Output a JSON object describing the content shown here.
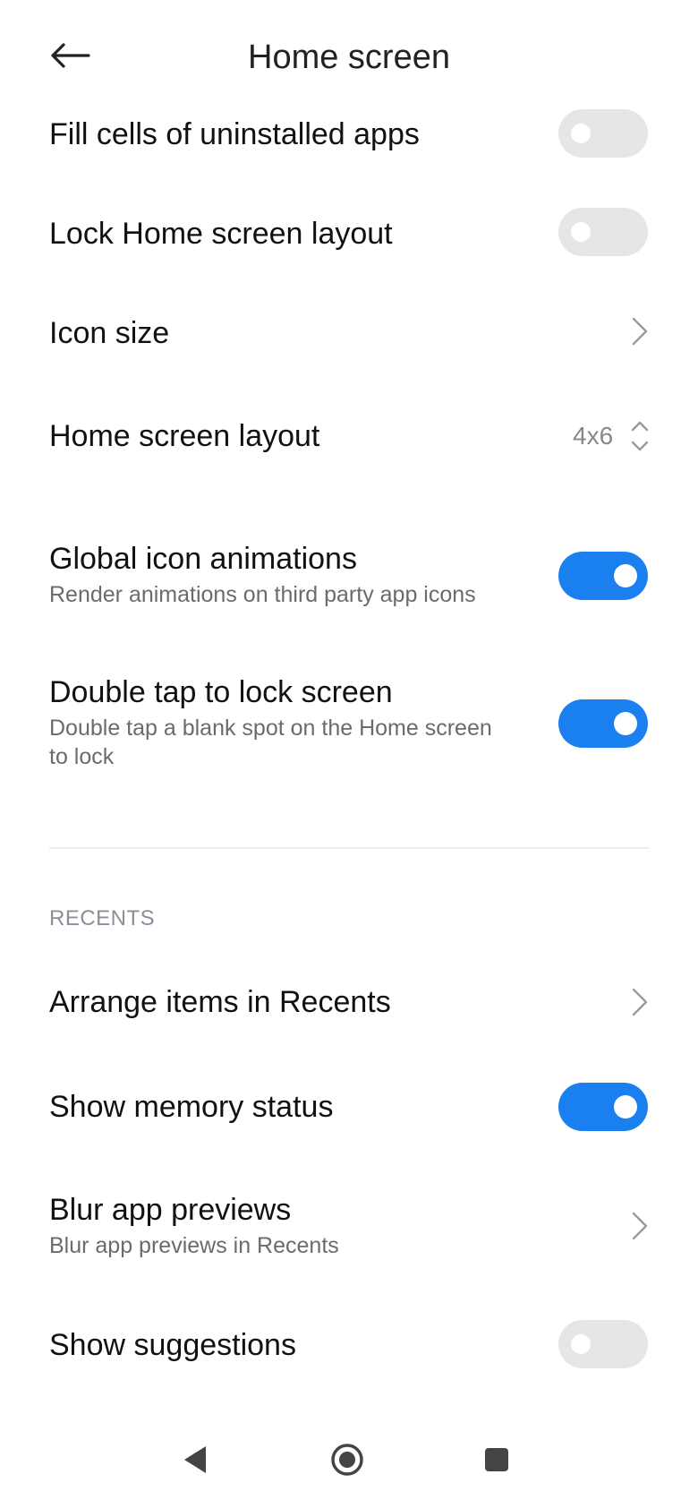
{
  "header": {
    "title": "Home screen",
    "back_icon": "arrow-left-icon"
  },
  "settings": {
    "fill_cells": {
      "title": "Fill cells of uninstalled apps",
      "enabled": false
    },
    "lock_layout": {
      "title": "Lock Home screen layout",
      "enabled": false
    },
    "icon_size": {
      "title": "Icon size"
    },
    "home_layout": {
      "title": "Home screen layout",
      "value": "4x6"
    },
    "global_icon_animations": {
      "title": "Global icon animations",
      "subtitle": "Render animations on third party app icons",
      "enabled": true
    },
    "double_tap_lock": {
      "title": "Double tap to lock screen",
      "subtitle_line1": "Double tap a blank spot on the Home screen",
      "subtitle_line2": "to lock",
      "enabled": true
    }
  },
  "recents": {
    "section_label": "RECENTS",
    "arrange_items": {
      "title": "Arrange items in Recents"
    },
    "memory_status": {
      "title": "Show memory status",
      "enabled": true
    },
    "blur_previews": {
      "title": "Blur app previews",
      "subtitle": "Blur app previews in Recents"
    },
    "suggestions": {
      "title": "Show suggestions",
      "enabled": false
    }
  },
  "navbar": {
    "back": "triangle-back-icon",
    "home": "circle-home-icon",
    "recents": "square-recents-icon"
  },
  "colors": {
    "accent": "#1a80f0",
    "toggle_off": "#e6e6e6",
    "secondary_text": "#6b6b6b"
  }
}
